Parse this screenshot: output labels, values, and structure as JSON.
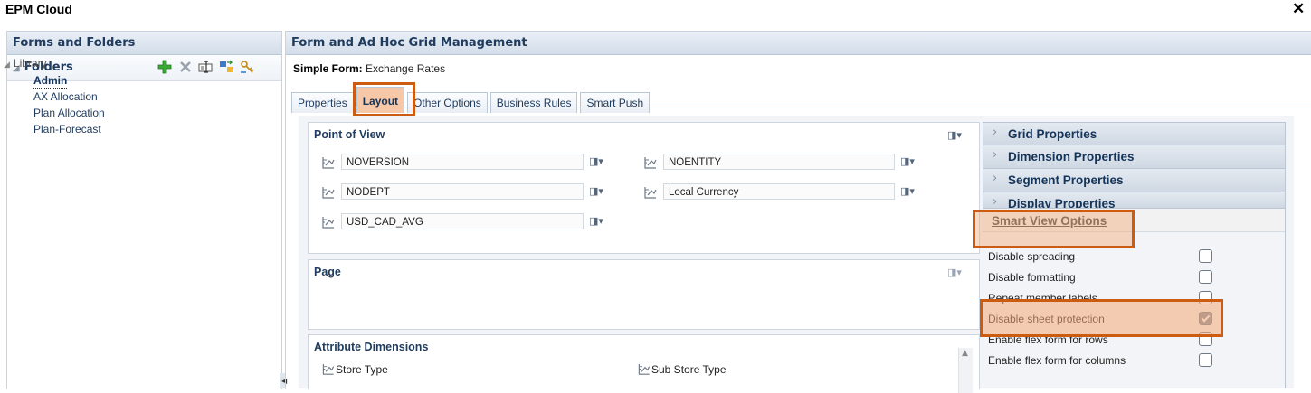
{
  "app": {
    "title": "EPM Cloud",
    "close_glyph": "✕"
  },
  "left_panel": {
    "header": "Forms and Folders",
    "header_underline": "m",
    "folders_label": "Folders",
    "toolbar_icons": [
      "add-icon",
      "delete-icon",
      "rename-icon",
      "move-icon",
      "assign-access-icon"
    ],
    "tree": {
      "root": "Library",
      "children": [
        {
          "label": "Admin",
          "selected": true
        },
        {
          "label": "AX Allocation",
          "selected": false
        },
        {
          "label": "Plan Allocation",
          "selected": false
        },
        {
          "label": "Plan-Forecast",
          "selected": false
        }
      ]
    }
  },
  "main": {
    "header": "Form and Ad Hoc Grid Management",
    "simple_form_label": "Simple Form:",
    "simple_form_name": "Exchange Rates",
    "tabs": [
      {
        "label": "Properties",
        "active": false
      },
      {
        "label": "Layout",
        "active": true
      },
      {
        "label": "Other Options",
        "active": false
      },
      {
        "label": "Business Rules",
        "active": false
      },
      {
        "label": "Smart Push",
        "active": false
      }
    ],
    "pov": {
      "title": "Point of View",
      "members": [
        "NOVERSION",
        "NOENTITY",
        "NODEPT",
        "Local Currency",
        "USD_CAD_AVG"
      ]
    },
    "page": {
      "title": "Page"
    },
    "attributes": {
      "title": "Attribute Dimensions",
      "items": [
        "Store Type",
        "Sub Store Type"
      ]
    },
    "accordion": [
      {
        "label": "Grid Properties",
        "open": false
      },
      {
        "label": "Dimension Properties",
        "open": false
      },
      {
        "label": "Segment Properties",
        "open": false
      },
      {
        "label": "Display Properties",
        "open": false
      },
      {
        "label": "Smart View Options",
        "open": true
      }
    ],
    "smart_view_options": [
      {
        "label": "Disable spreading",
        "checked": false
      },
      {
        "label": "Disable formatting",
        "checked": false
      },
      {
        "label": "Repeat member labels",
        "checked": false
      },
      {
        "label": "Disable sheet protection",
        "checked": true
      },
      {
        "label": "Enable flex form for rows",
        "checked": false
      },
      {
        "label": "Enable flex form for columns",
        "checked": false
      }
    ]
  },
  "colors": {
    "highlight_border": "#cc5c12",
    "highlight_fill": "#f4aa78",
    "header_text": "#1f3b5e"
  }
}
